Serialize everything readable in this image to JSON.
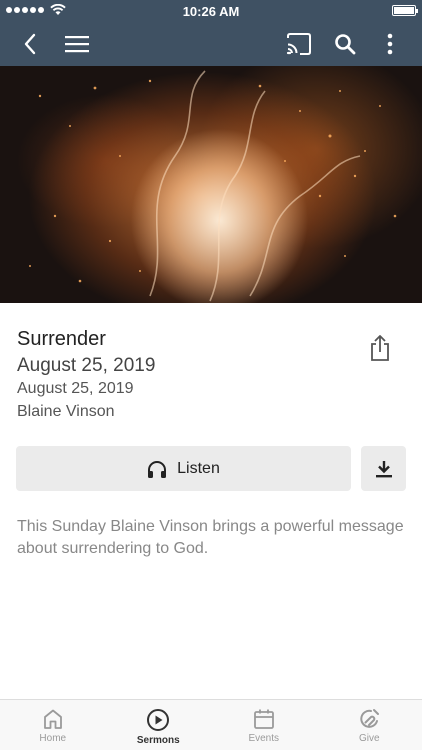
{
  "status_bar": {
    "time": "10:26 AM",
    "battery_level": 1.0
  },
  "nav_bar": {
    "icons": [
      "back-icon",
      "menu-icon",
      "cast-icon",
      "search-icon",
      "more-vertical-icon"
    ]
  },
  "hero": {
    "image": "fire-sparks-photo"
  },
  "sermon": {
    "title": "Surrender",
    "date_main": "August 25, 2019",
    "date_sub": "August 25, 2019",
    "speaker": "Blaine Vinson",
    "description": "This Sunday Blaine Vinson brings a powerful message about surrendering to God."
  },
  "actions": {
    "listen_label": "Listen",
    "listen_icon": "headphones-icon",
    "download_icon": "download-icon",
    "share_icon": "share-icon"
  },
  "tabs": [
    {
      "label": "Home",
      "icon": "home-icon",
      "active": false
    },
    {
      "label": "Sermons",
      "icon": "play-circle-icon",
      "active": true
    },
    {
      "label": "Events",
      "icon": "calendar-icon",
      "active": false
    },
    {
      "label": "Give",
      "icon": "give-icon",
      "active": false
    }
  ],
  "colors": {
    "nav_bar": "#3f5163",
    "button_bg": "#ebebeb",
    "tab_inactive": "#9a9a9a",
    "tab_active": "#333333"
  }
}
